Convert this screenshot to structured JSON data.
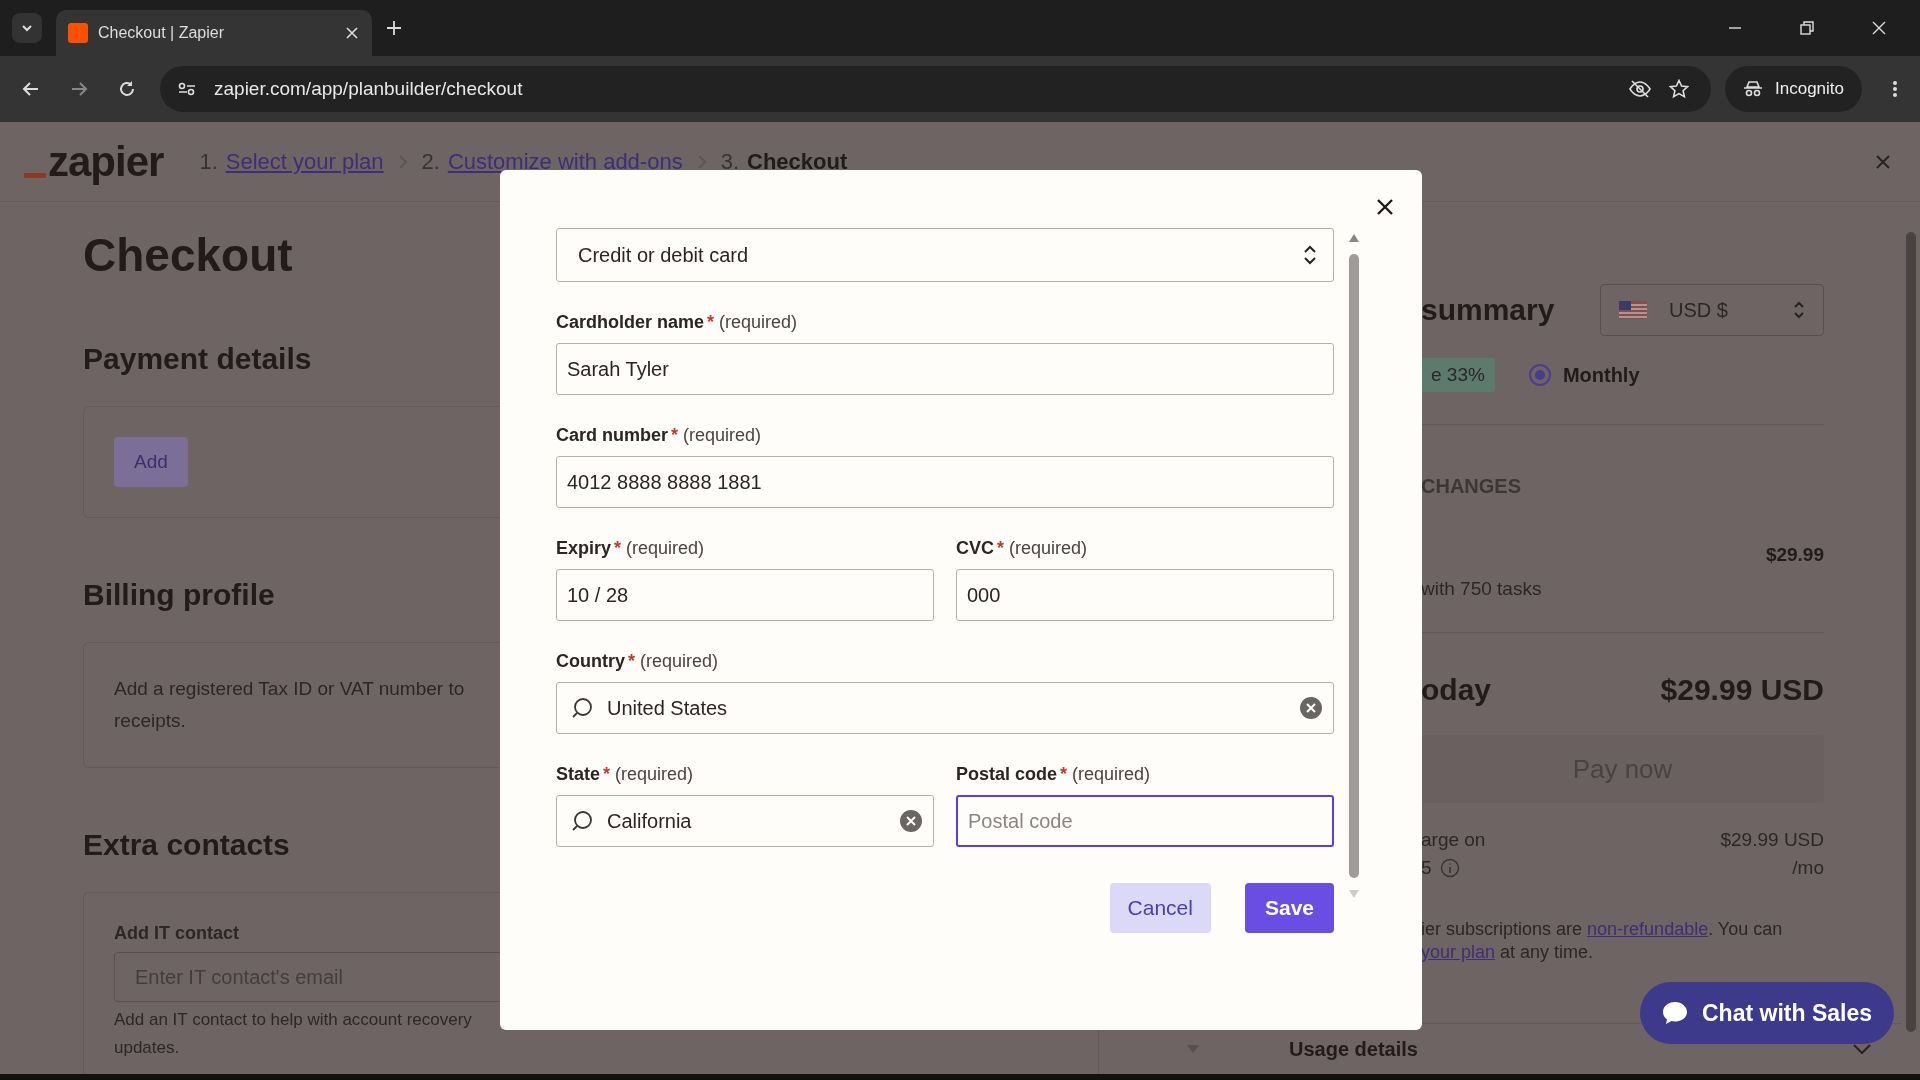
{
  "browser": {
    "tab_title": "Checkout | Zapier",
    "url": "zapier.com/app/planbuilder/checkout",
    "profile": "Incognito"
  },
  "header": {
    "logo": "zapier",
    "steps": [
      {
        "number": "1.",
        "label": "Select your plan",
        "kind": "link"
      },
      {
        "number": "2.",
        "label": "Customize with add-ons",
        "kind": "link"
      },
      {
        "number": "3.",
        "label": "Checkout",
        "kind": "current"
      }
    ]
  },
  "page": {
    "title": "Checkout",
    "payment": {
      "heading": "Payment details",
      "button": "Add"
    },
    "billing": {
      "heading": "Billing profile",
      "lines": [
        "Add a registered Tax ID or VAT number to",
        "receipts."
      ]
    },
    "contacts": {
      "heading": "Extra contacts",
      "label": "Add IT contact",
      "placeholder": "Enter IT contact's email",
      "help": "Add an IT contact to help with account recovery",
      "help_2": "updates."
    }
  },
  "summary": {
    "heading": "summary",
    "currency": "USD $",
    "badge": "e 33%",
    "billing_options": [
      {
        "label": "Monthly",
        "selected": true
      }
    ],
    "section": "CHANGES",
    "item_price": "$29.99",
    "item_note": "with 750 tasks",
    "total_label": "oday",
    "total": "$29.99 USD",
    "pay_button": "Pay now",
    "next_charge": [
      "arge on",
      "5"
    ],
    "next_amount": [
      "$29.99 USD",
      "/mo"
    ],
    "terms": {
      "before": "ier subscriptions are ",
      "link": "non-refundable",
      "after": ". You can"
    },
    "terms_2": {
      "link": "your plan",
      "after": " at any time."
    },
    "usage": "Usage details"
  },
  "chat_button": "Chat with Sales",
  "modal": {
    "payment_method": "Credit or debit card",
    "rows": [
      [
        {
          "label": "Cardholder name",
          "marker": "*",
          "note": "(required)",
          "kind": "text",
          "value": "Sarah Tyler",
          "focused": false
        }
      ],
      [
        {
          "label": "Card number",
          "marker": "*",
          "note": "(required)",
          "kind": "text",
          "value": "4012 8888 8888 1881",
          "focused": false
        }
      ],
      [
        {
          "label": "Expiry",
          "marker": "*",
          "note": "(required)",
          "kind": "text",
          "value": "10 / 28",
          "focused": false
        },
        {
          "label": "CVC",
          "marker": "*",
          "note": "(required)",
          "kind": "text",
          "value": "000",
          "focused": false
        }
      ],
      [
        {
          "label": "Country",
          "marker": "*",
          "note": "(required)",
          "kind": "search",
          "value": "United States",
          "focused": false
        }
      ],
      [
        {
          "label": "State",
          "marker": "*",
          "note": "(required)",
          "kind": "search",
          "value": "California",
          "focused": false
        },
        {
          "label": "Postal code",
          "marker": "*",
          "note": "(required)",
          "kind": "text",
          "placeholder": "Postal code",
          "focused": true
        }
      ]
    ],
    "buttons": [
      {
        "label": "Cancel",
        "kind": "secondary"
      },
      {
        "label": "Save",
        "kind": "primary"
      }
    ]
  }
}
